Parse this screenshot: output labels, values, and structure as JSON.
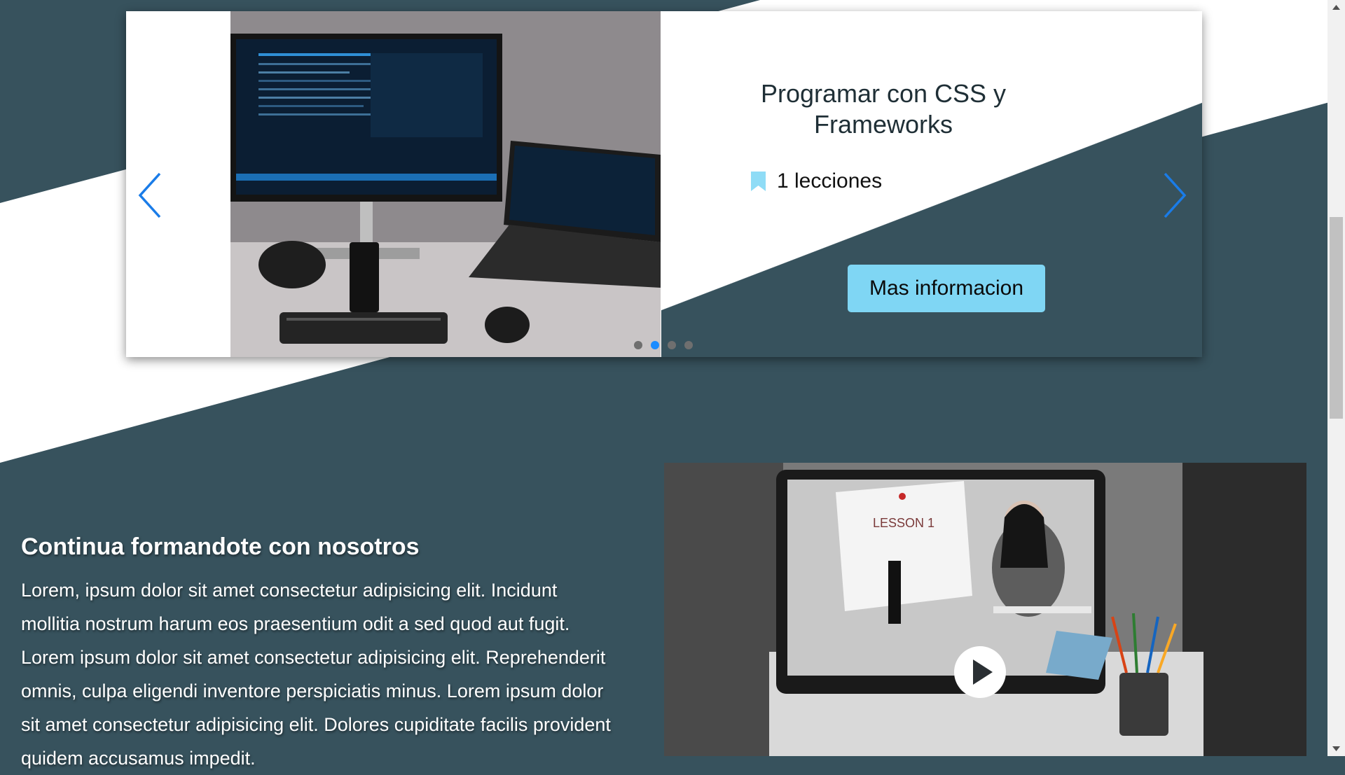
{
  "carousel": {
    "slide_title": "Programar con CSS y Frameworks",
    "lessons_text": "1 lecciones",
    "info_button_label": "Mas informacion",
    "photo_alt": "Desktop monitor and laptop showing code",
    "total_slides": 4,
    "active_slide": 2
  },
  "promo": {
    "title": "Continua formandote con nosotros",
    "body": "Lorem, ipsum dolor sit amet consectetur adipisicing elit. Incidunt mollitia nostrum harum eos praesentium odit a sed quod aut fugit. Lorem ipsum dolor sit amet consectetur adipisicing elit. Reprehenderit omnis, culpa eligendi inventore perspiciatis minus. Lorem ipsum dolor sit amet consectetur adipisicing elit. Dolores cupiditate facilis provident quidem accusamus impedit."
  },
  "video": {
    "whiteboard_text": "LESSON 1",
    "thumbnail_alt": "Video lesson thumbnail"
  },
  "icons": {
    "prev": "chevron-left-icon",
    "next": "chevron-right-icon",
    "lessons": "bookmark-icon",
    "play": "play-icon"
  },
  "colors": {
    "background_dark": "#37525d",
    "background_light": "#ffffff",
    "arrow_blue": "#1a7ce8",
    "button_bg": "#7fd6f4",
    "bookmark": "#8fdcf6",
    "dot_active": "#1a8cff",
    "dot_inactive": "#6f6f6f"
  }
}
